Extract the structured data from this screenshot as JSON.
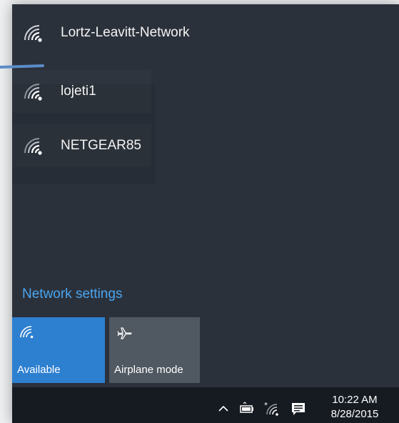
{
  "networks": [
    {
      "name": "Lortz-Leavitt-Network",
      "icon": "wifi-icon"
    },
    {
      "name": "lojeti1",
      "icon": "wifi-icon"
    },
    {
      "name": "NETGEAR85",
      "icon": "wifi-icon"
    }
  ],
  "network_settings_label": "Network settings",
  "tiles": {
    "available_label": "Available",
    "airplane_label": "Airplane mode"
  },
  "taskbar": {
    "time": "10:22 AM",
    "date": "8/28/2015",
    "icons": [
      "chevron-up-icon",
      "battery-icon",
      "wifi-icon",
      "action-center-icon"
    ]
  },
  "colors": {
    "flyout_bg": "#2b313b",
    "accent": "#2d7fd0",
    "link": "#4aa5f0",
    "taskbar_bg": "#161b22",
    "tile_inactive": "#505861"
  }
}
